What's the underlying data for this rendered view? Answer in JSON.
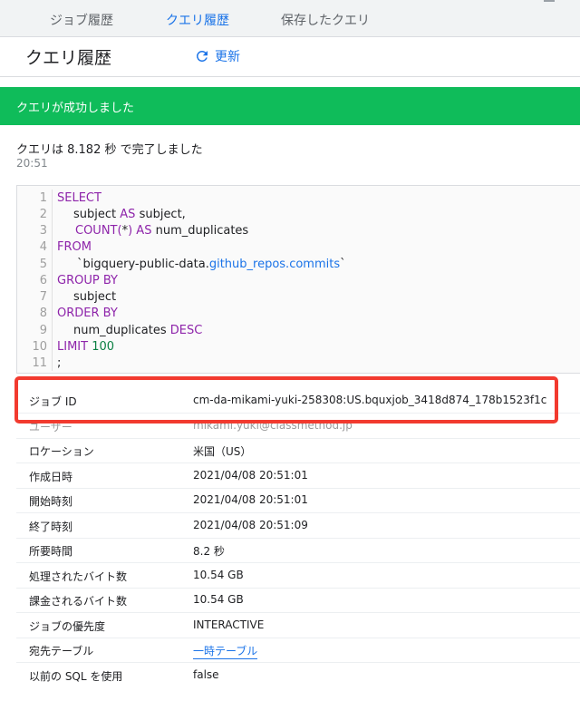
{
  "tabs": [
    "ジョブ履歴",
    "クエリ履歴",
    "保存したクエリ"
  ],
  "active_tab": 1,
  "header": {
    "title": "クエリ履歴",
    "refresh_label": "更新"
  },
  "banner": {
    "text": "クエリが成功しました"
  },
  "status": {
    "message": "クエリは 8.182 秒 で完了しました",
    "time": "20:51"
  },
  "code": {
    "line_numbers": [
      "1",
      "2",
      "3",
      "4",
      "5",
      "6",
      "7",
      "8",
      "9",
      "10",
      "11"
    ]
  },
  "details": [
    {
      "key": "ジョブ ID",
      "value": "cm-da-mikami-yuki-258308:US.bquxjob_3418d874_178b1523f1c"
    },
    {
      "key": "ユーザー",
      "value": "mikami.yuki@classmethod.jp"
    },
    {
      "key": "ロケーション",
      "value": "米国（US）"
    },
    {
      "key": "作成日時",
      "value": "2021/04/08 20:51:01"
    },
    {
      "key": "開始時刻",
      "value": "2021/04/08 20:51:01"
    },
    {
      "key": "終了時刻",
      "value": "2021/04/08 20:51:09"
    },
    {
      "key": "所要時間",
      "value": "8.2 秒"
    },
    {
      "key": "処理されたバイト数",
      "value": "10.54 GB"
    },
    {
      "key": "課金されるバイト数",
      "value": "10.54 GB"
    },
    {
      "key": "ジョブの優先度",
      "value": "INTERACTIVE"
    },
    {
      "key": "宛先テーブル",
      "value": "一時テーブル"
    },
    {
      "key": "以前の SQL を使用",
      "value": "false"
    }
  ],
  "sql": {
    "select": "SELECT",
    "l2_a": "subject",
    "l2_as": "AS",
    "l2_b": "subject,",
    "l3_count": "COUNT",
    "l3_p1": "(",
    "l3_star": "*",
    "l3_p2": ")",
    "l3_as": "AS",
    "l3_b": "num_duplicates",
    "from": "FROM",
    "l5_a": "`bigquery-public-data.",
    "l5_tbl": "github_repos.commits",
    "l5_b": "`",
    "group_by": "GROUP BY",
    "l7": "subject",
    "order_by": "ORDER BY",
    "l9_a": "num_duplicates",
    "l9_desc": "DESC",
    "limit": "LIMIT",
    "limit_val": "100",
    "semicolon": ";"
  },
  "colors": {
    "accent": "#1a73e8",
    "success": "#0fbc5a",
    "highlight": "#f23a2f",
    "keyword": "#8e24aa"
  }
}
